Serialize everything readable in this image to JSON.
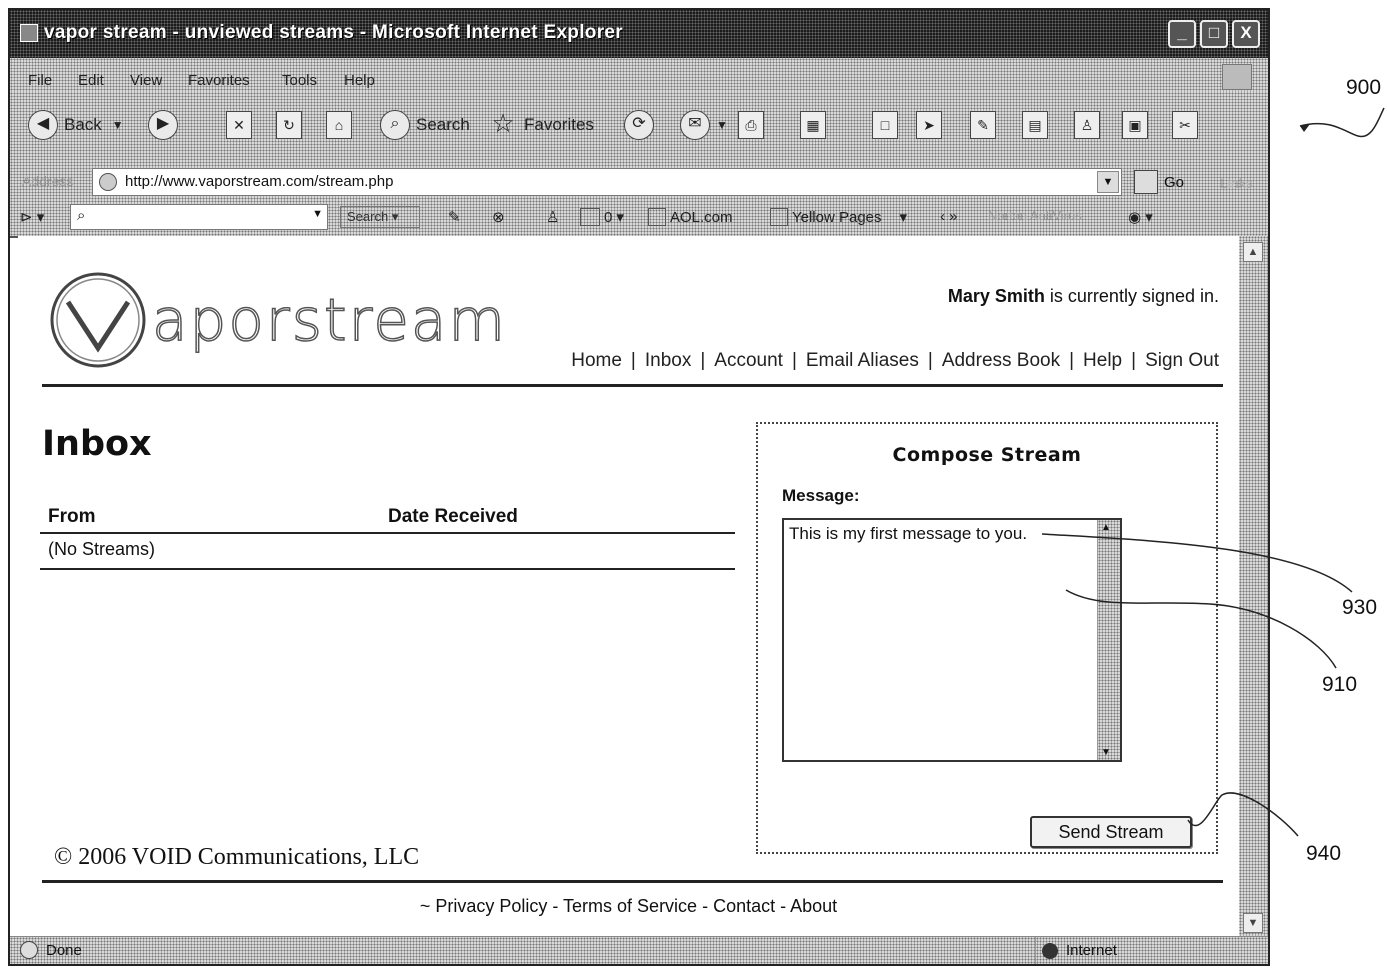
{
  "window": {
    "title": "vapor stream - unviewed streams - Microsoft Internet Explorer",
    "controls": {
      "minimize": "_",
      "maximize": "□",
      "close": "X"
    }
  },
  "menubar": {
    "items": [
      "File",
      "Edit",
      "View",
      "Favorites",
      "Tools",
      "Help"
    ]
  },
  "toolbar": {
    "back_label": "Back",
    "search_label": "Search",
    "favorites_label": "Favorites"
  },
  "addressbar": {
    "label": "Address",
    "url": "http://www.vaporstream.com/stream.php",
    "go_label": "Go",
    "links_label": "Links"
  },
  "toolbar2": {
    "search_button_label": "Search",
    "counter": "0",
    "aol_label": "AOL.com",
    "yellow_pages_label": "Yellow Pages",
    "norton_label": "Norton AntiVirus"
  },
  "page": {
    "logo_text": "aporstream",
    "signed_in_user": "Mary Smith",
    "signed_in_suffix": "is currently signed in.",
    "nav": [
      "Home",
      "Inbox",
      "Account",
      "Email Aliases",
      "Address Book",
      "Help",
      "Sign Out"
    ],
    "inbox_title": "Inbox",
    "table": {
      "columns": [
        "From",
        "Date Received"
      ],
      "empty_text": "(No Streams)"
    },
    "compose": {
      "title": "Compose Stream",
      "message_label": "Message:",
      "message_value": "This is my first message to you.",
      "send_label": "Send Stream"
    },
    "copyright": "© 2006 VOID Communications, LLC",
    "footer_links": "~ Privacy Policy - Terms of Service - Contact - About"
  },
  "statusbar": {
    "status": "Done",
    "zone": "Internet"
  },
  "callouts": {
    "figure": "900",
    "message_text": "930",
    "message_area": "910",
    "send_button": "940"
  }
}
